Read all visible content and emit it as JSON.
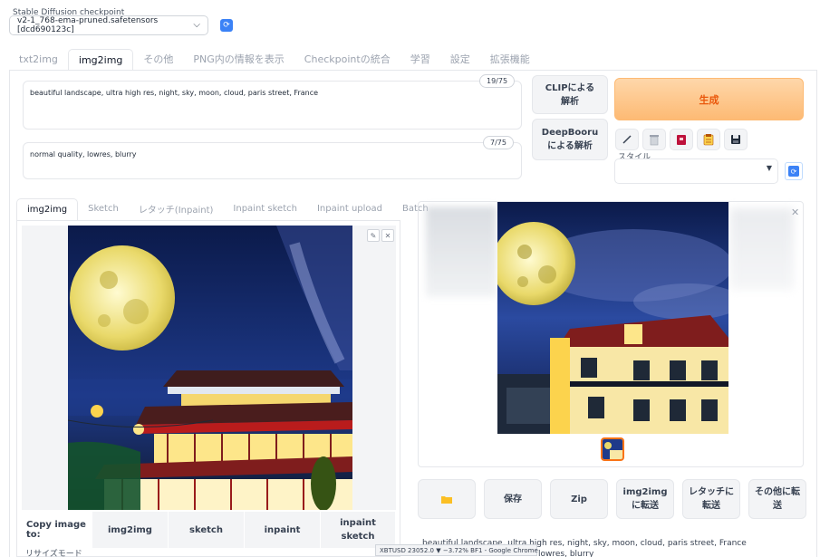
{
  "checkpoint": {
    "label": "Stable Diffusion checkpoint",
    "value": "v2-1_768-ema-pruned.safetensors [dcd690123c]"
  },
  "top_tabs": [
    "txt2img",
    "img2img",
    "その他",
    "PNG内の情報を表示",
    "Checkpointの統合",
    "学習",
    "設定",
    "拡張機能"
  ],
  "prompt": {
    "positive": "beautiful landscape, ultra high res, night,  sky,  moon, cloud, paris street, France",
    "positive_tokens": "19/75",
    "negative": "normal quality,  lowres, blurry",
    "negative_tokens": "7/75"
  },
  "buttons": {
    "clip": "CLIPによる解析",
    "deepbooru": "DeepBooruによる解析",
    "generate": "生成"
  },
  "tools": [
    "pencil-icon",
    "trash-icon",
    "red-card-icon",
    "clipboard-icon",
    "save-icon"
  ],
  "style": {
    "label": "スタイル"
  },
  "sub_tabs": [
    "img2img",
    "Sketch",
    "レタッチ(Inpaint)",
    "Inpaint sketch",
    "Inpaint upload",
    "Batch"
  ],
  "copy": {
    "label": "Copy image to:",
    "targets": [
      "img2img",
      "sketch",
      "inpaint",
      "inpaint sketch"
    ]
  },
  "resize": {
    "label": "リサイズモード"
  },
  "actions": [
    "保存",
    "Zip",
    "img2imgに転送",
    "レタッチに転送",
    "その他に転送"
  ],
  "output": {
    "info_line1": "beautiful landscape, ultra high res, night, sky, moon, cloud, paris street, France",
    "info_line2": "lowres, blurry"
  },
  "tooltip": "XBTUSD 23052.0 ▼ −3.72% BF1 - Google Chrome",
  "colors": {
    "generate_bg": "#fdba74",
    "generate_text": "#ea580c",
    "refresh": "#3b82f6"
  }
}
